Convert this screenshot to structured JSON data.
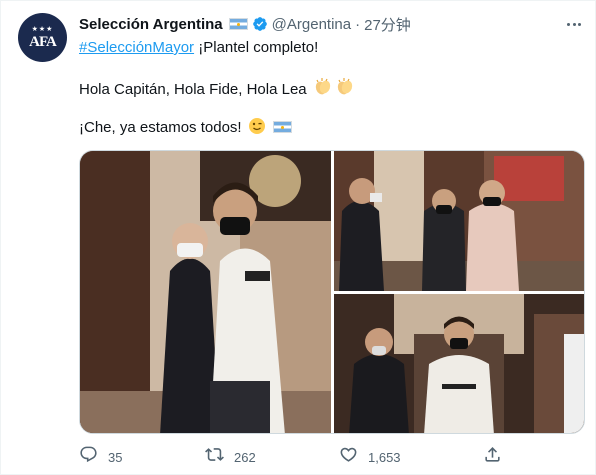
{
  "tweet": {
    "avatar_text": "AFA",
    "display_name": "Selección Argentina",
    "handle": "@Argentina",
    "separator": "·",
    "time": "27分钟",
    "hashtag": "#SelecciónMayor",
    "line1_rest": " ¡Plantel completo!",
    "line2": "Hola Capitán, Hola Fide, Hola Lea",
    "line3": "¡Che, ya estamos todos!",
    "icons": {
      "verified": "verified-badge-icon",
      "flag": "argentina-flag-icon",
      "more": "more-options-icon",
      "clap": "clapping-hands-emoji",
      "wink": "winking-face-emoji"
    },
    "colors": {
      "accent": "#1d9bf0",
      "text": "#0f1419",
      "secondary": "#536471",
      "flag_blue": "#74acdf"
    }
  },
  "media": {
    "photos": [
      "photo-arrival-lobby",
      "photo-greeting-players",
      "photo-walking-hallway"
    ]
  },
  "actions": {
    "reply_count": "35",
    "retweet_count": "262",
    "like_count": "1,653"
  }
}
